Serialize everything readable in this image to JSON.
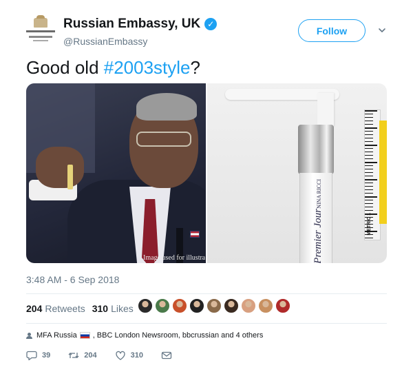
{
  "account": {
    "display_name": "Russian Embassy, UK",
    "handle": "@RussianEmbassy",
    "verified_icon": "verified-badge-icon"
  },
  "header": {
    "follow_label": "Follow",
    "menu_icon": "chevron-down-icon"
  },
  "tweet": {
    "text_prefix": "Good old ",
    "hashtag": "#2003style",
    "text_suffix": "?",
    "timestamp": "3:48 AM - 6 Sep 2018"
  },
  "media": {
    "left_caption": "Image used for illustra",
    "bottle_brand": "Premier Jour",
    "bottle_sub": "NINA RICCI",
    "ruler_label": "METRIC 1"
  },
  "stats": {
    "retweets_count": "204",
    "retweets_label": "Retweets",
    "likes_count": "310",
    "likes_label": "Likes"
  },
  "likers": [
    "#2a2a2a",
    "#4a7a4a",
    "#c8502a",
    "#222222",
    "#8a6a4a",
    "#3a2a20",
    "#d8a080",
    "#c89060",
    "#b02a2a"
  ],
  "context": {
    "text_before_flag": "MFA Russia",
    "text_after_flag": ", BBC London Newsroom, bbcrussian and 4 others"
  },
  "actions": {
    "reply_count": "39",
    "retweet_count": "204",
    "like_count": "310"
  },
  "colors": {
    "accent": "#1da1f2",
    "muted": "#657786",
    "text": "#14171a"
  }
}
